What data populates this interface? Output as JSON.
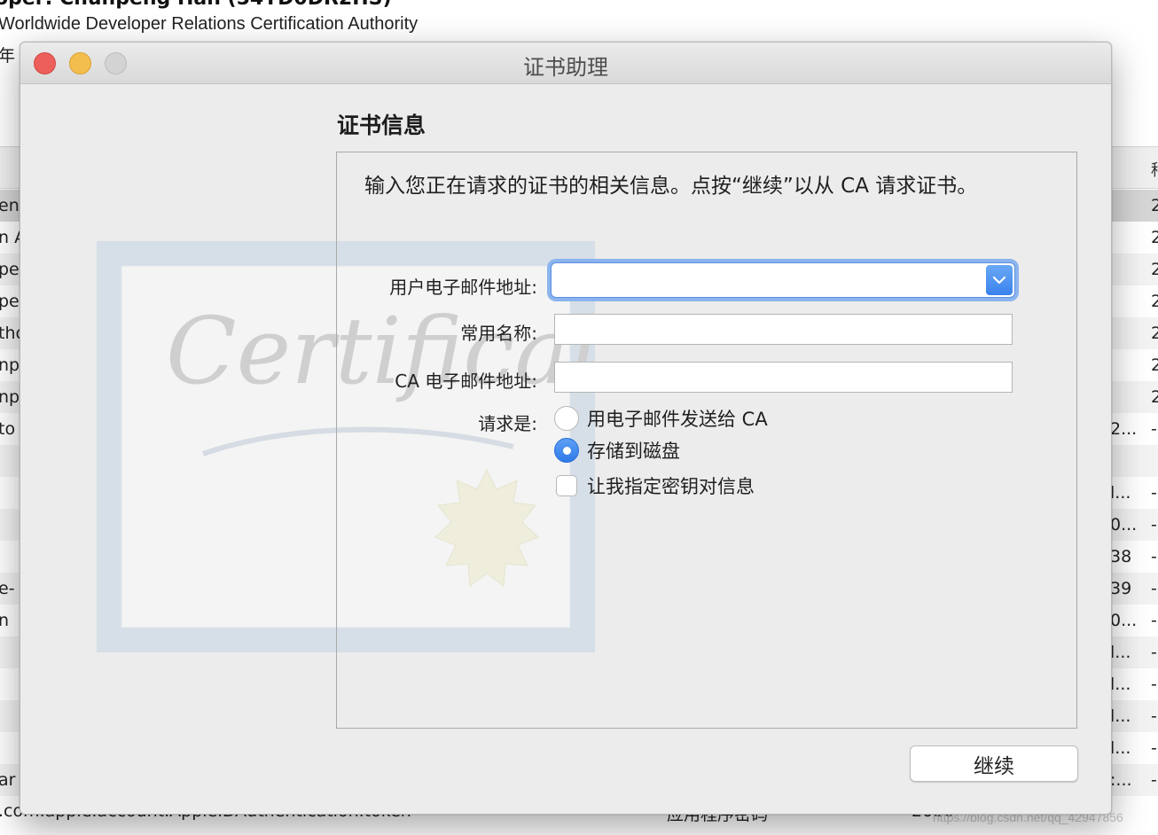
{
  "background_window": {
    "title_fragment": "oper: Chunpeng Han (54YD0DR2HS)",
    "issuer_fragment": "Worldwide Developer Relations Certification Authority",
    "year_fragment": "年",
    "column_header_fragment": "种",
    "rows": [
      {
        "left": "en",
        "right": "",
        "dash": "2"
      },
      {
        "left": "n A",
        "right": "",
        "dash": "2"
      },
      {
        "left": "pe",
        "right": "",
        "dash": "2"
      },
      {
        "left": "per",
        "right": "",
        "dash": "2"
      },
      {
        "left": "tho",
        "right": "",
        "dash": "2"
      },
      {
        "left": "np",
        "right": "",
        "dash": "2"
      },
      {
        "left": "np",
        "right": "",
        "dash": "2"
      },
      {
        "left": "to",
        "right": "2...",
        "dash": "-"
      },
      {
        "left": "",
        "right": "",
        "dash": ""
      },
      {
        "left": "",
        "right": "l...",
        "dash": "-"
      },
      {
        "left": "",
        "right": "0...",
        "dash": "-"
      },
      {
        "left": "",
        "right": "38",
        "dash": "-"
      },
      {
        "left": "e-",
        "right": "39",
        "dash": "-"
      },
      {
        "left": "n",
        "right": "0...",
        "dash": "-"
      },
      {
        "left": "",
        "right": "l...",
        "dash": "-"
      },
      {
        "left": "",
        "right": "l...",
        "dash": "-"
      },
      {
        "left": "",
        "right": "l...",
        "dash": "-"
      },
      {
        "left": "",
        "right": "l...",
        "dash": "-"
      },
      {
        "left": "ar",
        "right": ":...",
        "dash": "-"
      }
    ],
    "bottom_row": {
      "name": ".com.apple.account.AppleIDAuthentication.token",
      "kind": "应用程序密码",
      "date": "2020"
    },
    "watermark": "https://blog.csdn.net/qq_42947856"
  },
  "window": {
    "title": "证书助理"
  },
  "cert_art": {
    "text": "Certificate"
  },
  "form": {
    "section_title": "证书信息",
    "intro": "输入您正在请求的证书的相关信息。点按“继续”以从 CA 请求证书。",
    "email_label": "用户电子邮件地址:",
    "email_value": "",
    "name_label": "常用名称:",
    "name_value": "",
    "ca_email_label": "CA 电子邮件地址:",
    "ca_email_value": "",
    "request_label": "请求是:",
    "option_email_ca": "用电子邮件发送给 CA",
    "option_save_disk": "存储到磁盘",
    "option_key_pair": "让我指定密钥对信息",
    "selected_option": "存储到磁盘",
    "key_pair_checked": false
  },
  "buttons": {
    "continue": "继续"
  },
  "colors": {
    "accent": "#3a82ee",
    "focus_ring": "#8bb4ee",
    "close": "#ec5f5a",
    "minimize": "#f4be4f",
    "zoom_inactive": "#d3d3d3"
  }
}
